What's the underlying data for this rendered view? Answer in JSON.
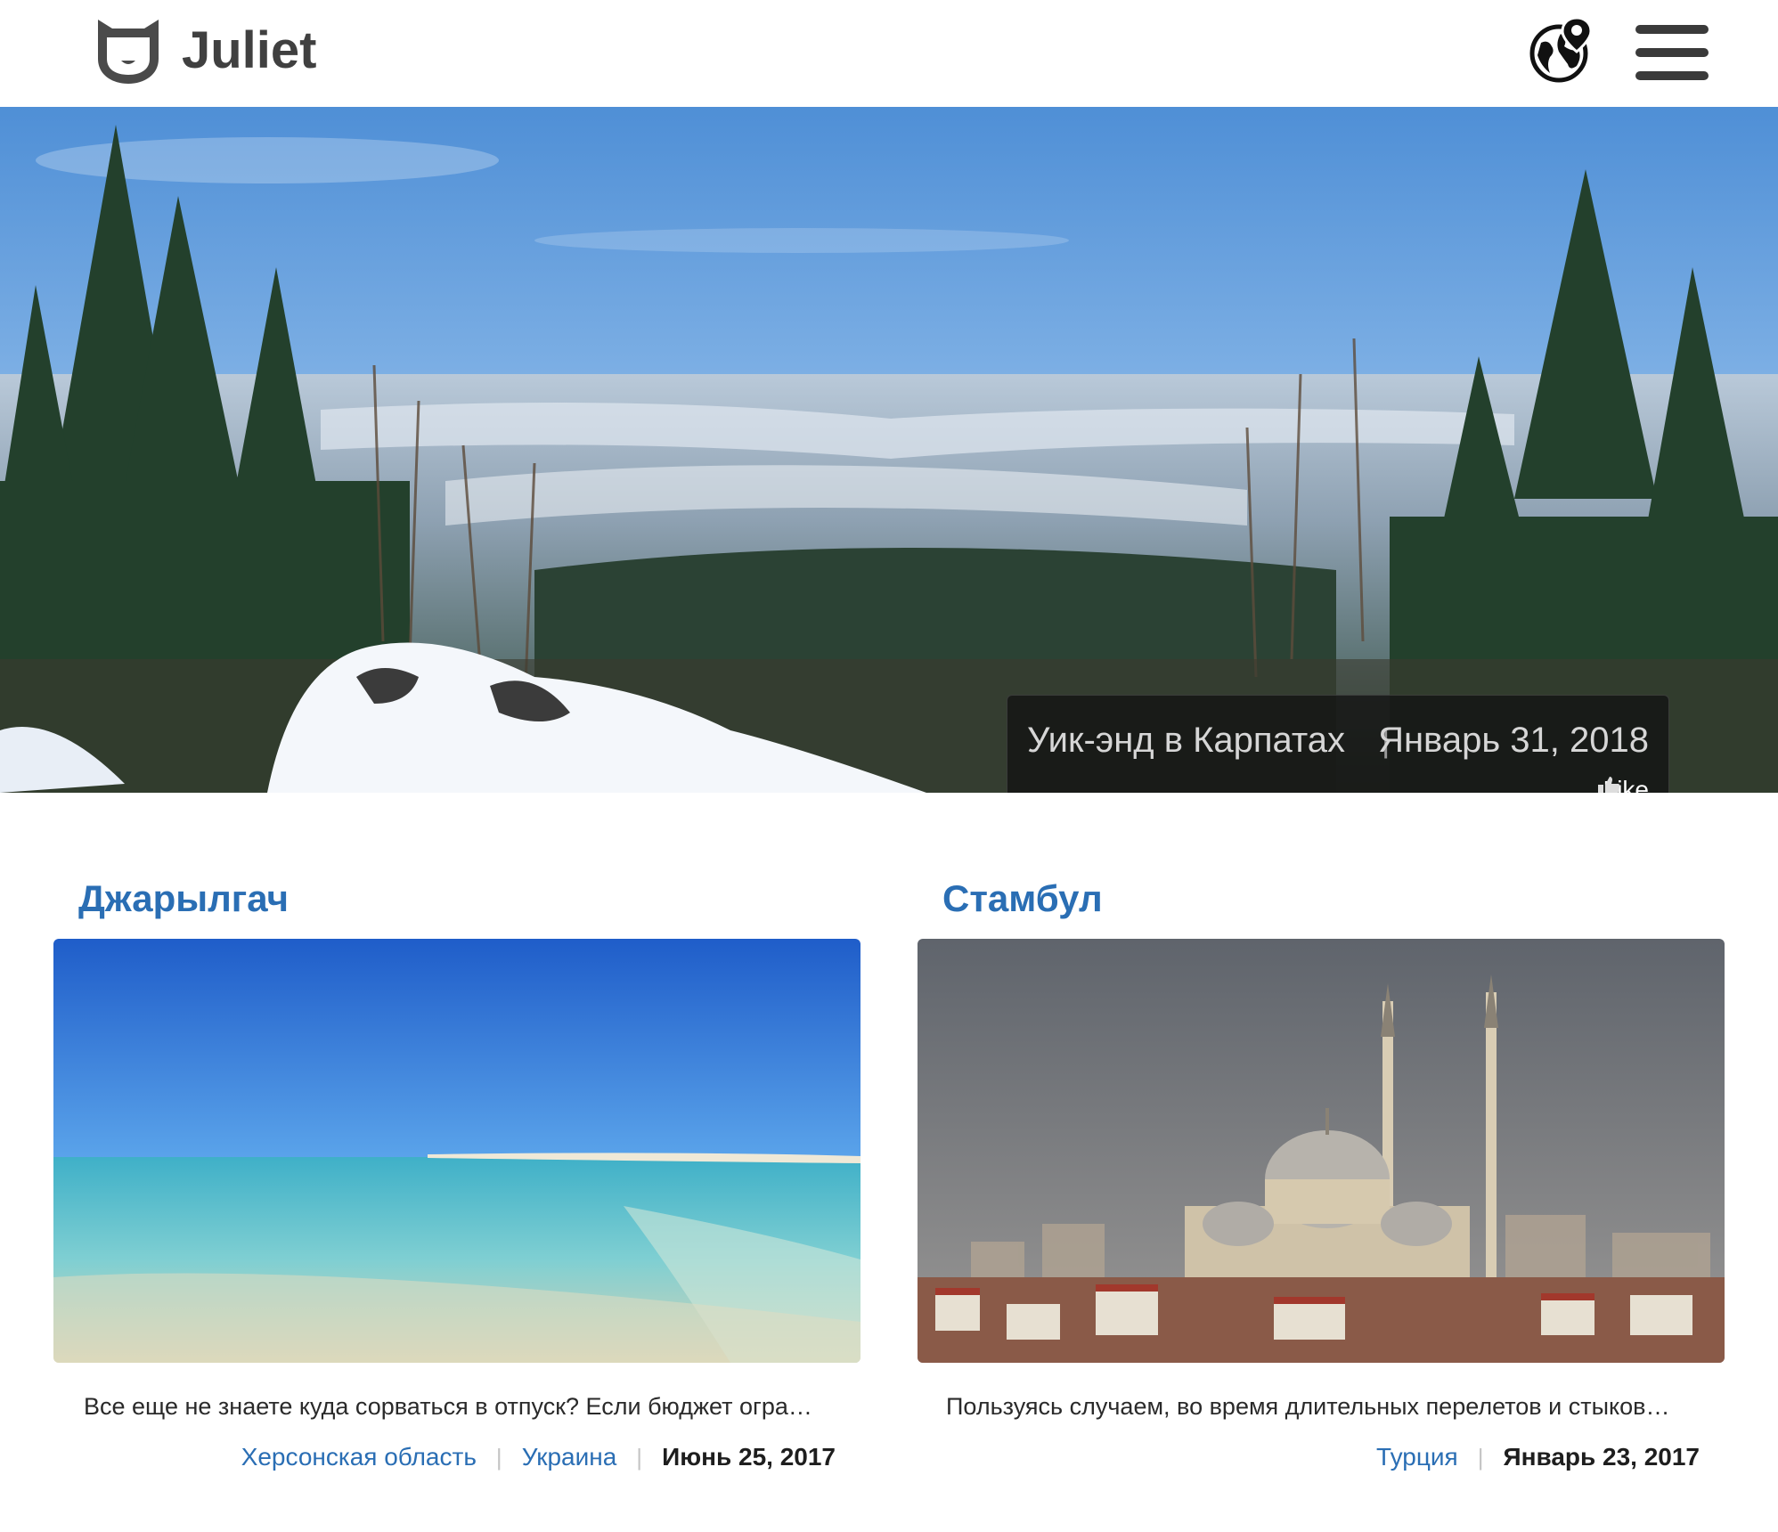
{
  "header": {
    "brand": "Juliet",
    "logo_icon": "cat-shield-icon",
    "globe_icon": "globe-pin-icon",
    "menu_icon": "hamburger-menu-icon"
  },
  "hero": {
    "title": "Уик-энд в Карпатах",
    "separator": "|",
    "date": "Январь 31, 2018",
    "like_label": "Like",
    "like_icon": "thumbs-up-icon"
  },
  "posts": [
    {
      "title": "Джарылгач",
      "excerpt": "Все еще не знаете куда сорваться в отпуск? Если бюджет огра…",
      "tags": [
        "Херсонская область",
        "Украина"
      ],
      "date": "Июнь 25, 2017"
    },
    {
      "title": "Стамбул",
      "excerpt": "Пользуясь случаем, во время длительных перелетов и стыков…",
      "tags": [
        "Турция"
      ],
      "date": "Январь 23, 2017"
    }
  ],
  "colors": {
    "accent": "#2a6eb4",
    "brand_text": "#404040",
    "caption_bg": "#121212"
  }
}
